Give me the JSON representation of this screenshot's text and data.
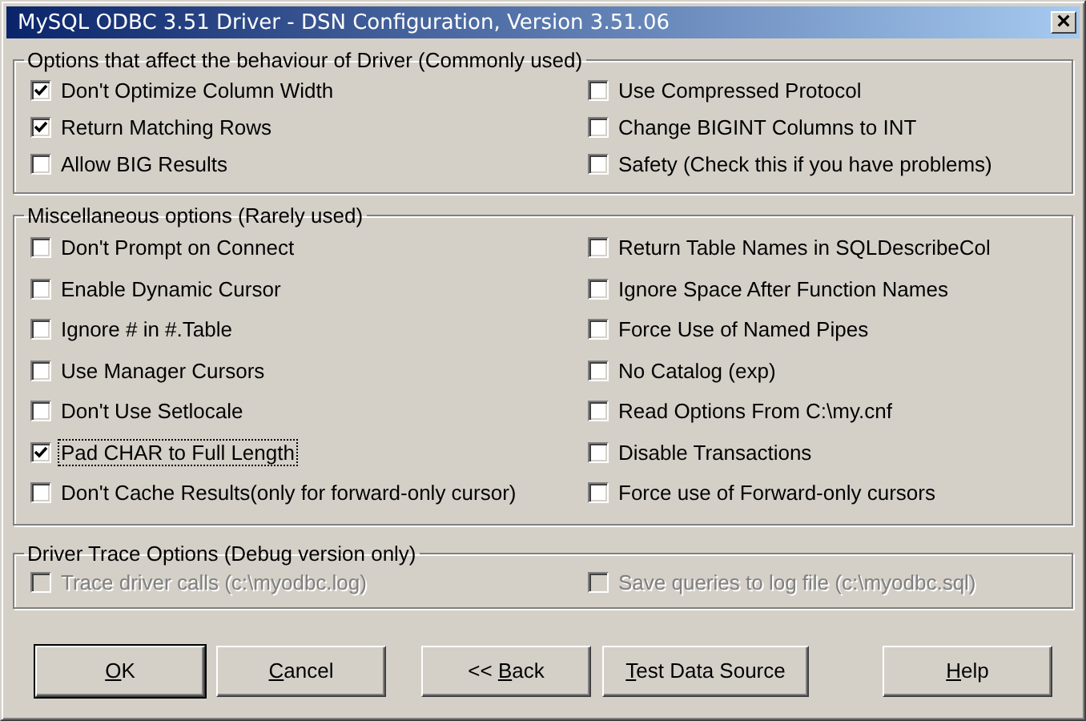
{
  "window": {
    "title": "MySQL ODBC 3.51 Driver - DSN Configuration, Version 3.51.06",
    "close_glyph": "×"
  },
  "sections": [
    {
      "kind": "normal",
      "title": "Options that affect the behaviour of Driver (Commonly used)",
      "disabled": false,
      "options": [
        {
          "label": "Don't Optimize Column Width",
          "checked": true,
          "focused": false
        },
        {
          "label": "Use Compressed Protocol",
          "checked": false,
          "focused": false
        },
        {
          "label": "Return Matching Rows",
          "checked": true,
          "focused": false
        },
        {
          "label": "Change BIGINT Columns to INT",
          "checked": false,
          "focused": false
        },
        {
          "label": "Allow BIG Results",
          "checked": false,
          "focused": false
        },
        {
          "label": "Safety (Check this if you have problems)",
          "checked": false,
          "focused": false
        }
      ]
    },
    {
      "kind": "normal",
      "title": "Miscellaneous options (Rarely used)",
      "disabled": false,
      "options": [
        {
          "label": "Don't Prompt on Connect",
          "checked": false,
          "focused": false
        },
        {
          "label": "Return Table Names in SQLDescribeCol",
          "checked": false,
          "focused": false
        },
        {
          "label": "Enable Dynamic Cursor",
          "checked": false,
          "focused": false
        },
        {
          "label": "Ignore Space After Function Names",
          "checked": false,
          "focused": false
        },
        {
          "label": "Ignore # in #.Table",
          "checked": false,
          "focused": false
        },
        {
          "label": "Force Use of Named Pipes",
          "checked": false,
          "focused": false
        },
        {
          "label": "Use Manager Cursors",
          "checked": false,
          "focused": false
        },
        {
          "label": "No Catalog (exp)",
          "checked": false,
          "focused": false
        },
        {
          "label": "Don't Use Setlocale",
          "checked": false,
          "focused": false
        },
        {
          "label": "Read Options From C:\\my.cnf",
          "checked": false,
          "focused": false
        },
        {
          "label": "Pad CHAR to Full Length",
          "checked": true,
          "focused": true
        },
        {
          "label": "Disable Transactions",
          "checked": false,
          "focused": false
        },
        {
          "label": "Don't Cache Results(only for forward-only cursor)",
          "checked": false,
          "focused": false
        },
        {
          "label": "Force use of Forward-only cursors",
          "checked": false,
          "focused": false
        }
      ]
    },
    {
      "kind": "trace",
      "title": "Driver Trace Options (Debug version only)",
      "disabled": true,
      "options": [
        {
          "label": "Trace driver calls (c:\\myodbc.log)",
          "checked": false,
          "focused": false
        },
        {
          "label": "Save queries to log file (c:\\myodbc.sql)",
          "checked": false,
          "focused": false
        }
      ]
    }
  ],
  "buttons": [
    {
      "access_key": "O",
      "after": "K",
      "default": true,
      "kind": "ok"
    },
    {
      "access_key": "C",
      "after": "ancel",
      "default": false,
      "kind": "cancel"
    },
    {
      "before": "<< ",
      "access_key": "B",
      "after": "ack",
      "default": false,
      "kind": "back"
    },
    {
      "access_key": "T",
      "after": "est Data Source",
      "default": false,
      "kind": "test"
    },
    {
      "access_key": "H",
      "after": "elp",
      "default": false,
      "kind": "help"
    }
  ]
}
